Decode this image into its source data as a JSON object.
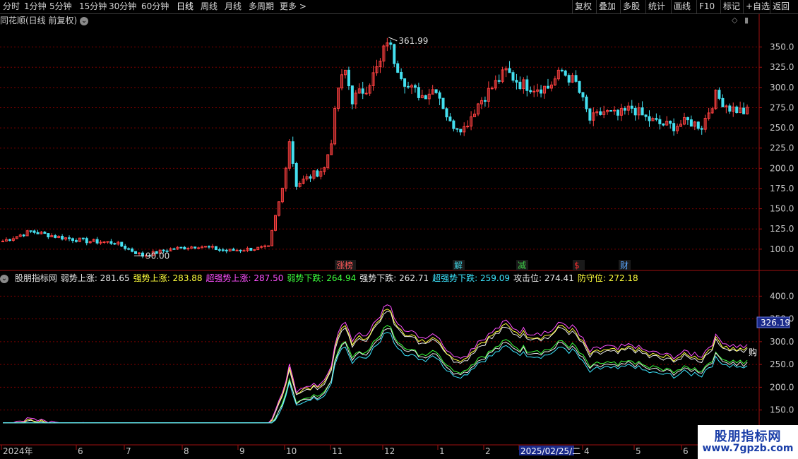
{
  "toolbar": {
    "periods": [
      "分时",
      "1分钟",
      "5分钟",
      "15分钟",
      "30分钟",
      "60分钟",
      "日线",
      "周线",
      "月线",
      "多周期",
      "更多 >"
    ],
    "active_period": "日线",
    "right_buttons": [
      "复权",
      "叠加",
      "多股",
      "统计",
      "画线",
      "F10",
      "标记",
      "+自选",
      "返回"
    ]
  },
  "main_chart": {
    "title": "同花顺(日线 前复权)",
    "y_ticks": [
      "350.0",
      "325.0",
      "300.0",
      "275.0",
      "250.0",
      "225.0",
      "200.0",
      "175.0",
      "150.0",
      "125.0",
      "100.0"
    ],
    "high_label": "361.99",
    "low_label": "90.00",
    "events": [
      {
        "label": "涨榜",
        "color": "#ff5a5a"
      },
      {
        "label": "解",
        "color": "#3fd0e0"
      },
      {
        "label": "减",
        "color": "#3fd24a"
      },
      {
        "label": "$",
        "color": "#ff3030"
      },
      {
        "label": "财",
        "color": "#5aa8ff"
      }
    ]
  },
  "indicator": {
    "name": "股朋指标网",
    "values": [
      {
        "label": "弱势上涨: 281.65",
        "color": "#e8e8e8"
      },
      {
        "label": "强势上涨: 283.88",
        "color": "#ffff3c"
      },
      {
        "label": "超强势上涨: 287.50",
        "color": "#ff50ff"
      },
      {
        "label": "弱势下跌: 264.94",
        "color": "#3cff3c"
      },
      {
        "label": "强势下跌: 262.71",
        "color": "#e8e8e8"
      },
      {
        "label": "超强势下跌: 259.09",
        "color": "#3ce6ff"
      },
      {
        "label": "攻击位: 274.41",
        "color": "#e8e8e8"
      },
      {
        "label": "防守位: 272.18",
        "color": "#ffff3c"
      }
    ],
    "y_ticks": [
      "400.0",
      "350.0",
      "300.0",
      "250.0",
      "200.0",
      "150.0"
    ],
    "cursor_value": "326.19",
    "buy_label": "购"
  },
  "x_axis": {
    "labels": [
      "2024年",
      "6",
      "7",
      "8",
      "9",
      "10",
      "11",
      "12",
      "1",
      "2",
      "2025/02/25/二",
      "4",
      "5",
      "6"
    ]
  },
  "watermark": {
    "line1": "股朋指标网",
    "line2": "www.7gpzb.com"
  },
  "colors": {
    "up": "#ff4040",
    "down": "#44e0f0",
    "grid": "#7a0000",
    "axis": "#a01010",
    "tick_text": "#c8c8c8"
  },
  "chart_data": {
    "type": "candlestick",
    "x": [
      "2024-05",
      "2024-06",
      "2024-07",
      "2024-08",
      "2024-09",
      "2024-10",
      "2024-11",
      "2024-12",
      "2025-01",
      "2025-02",
      "2025-03",
      "2025-04",
      "2025-05",
      "2025-06"
    ],
    "close_points": [
      [
        0,
        110
      ],
      [
        4,
        122
      ],
      [
        8,
        115
      ],
      [
        12,
        110
      ],
      [
        16,
        108
      ],
      [
        20,
        92
      ],
      [
        24,
        100
      ],
      [
        28,
        104
      ],
      [
        32,
        98
      ],
      [
        35,
        100
      ],
      [
        38,
        102
      ],
      [
        39,
        140
      ],
      [
        40,
        175
      ],
      [
        41,
        235
      ],
      [
        42,
        180
      ],
      [
        44,
        190
      ],
      [
        46,
        200
      ],
      [
        47,
        235
      ],
      [
        48,
        300
      ],
      [
        49,
        320
      ],
      [
        50,
        285
      ],
      [
        52,
        300
      ],
      [
        54,
        330
      ],
      [
        55,
        360
      ],
      [
        56,
        335
      ],
      [
        58,
        300
      ],
      [
        60,
        290
      ],
      [
        62,
        300
      ],
      [
        64,
        255
      ],
      [
        66,
        250
      ],
      [
        68,
        280
      ],
      [
        70,
        300
      ],
      [
        72,
        320
      ],
      [
        74,
        305
      ],
      [
        76,
        300
      ],
      [
        78,
        300
      ],
      [
        80,
        320
      ],
      [
        82,
        305
      ],
      [
        84,
        260
      ],
      [
        86,
        270
      ],
      [
        88,
        265
      ],
      [
        90,
        275
      ],
      [
        92,
        262
      ],
      [
        94,
        255
      ],
      [
        96,
        252
      ],
      [
        98,
        258
      ],
      [
        100,
        252
      ],
      [
        102,
        290
      ],
      [
        104,
        275
      ],
      [
        106,
        270
      ]
    ],
    "ylim": [
      85,
      375
    ],
    "indicator_series": [
      "弱势上涨",
      "强势上涨",
      "超强势上涨",
      "弱势下跌",
      "强势下跌",
      "超强势下跌"
    ],
    "indicator_ylim": [
      120,
      430
    ]
  }
}
